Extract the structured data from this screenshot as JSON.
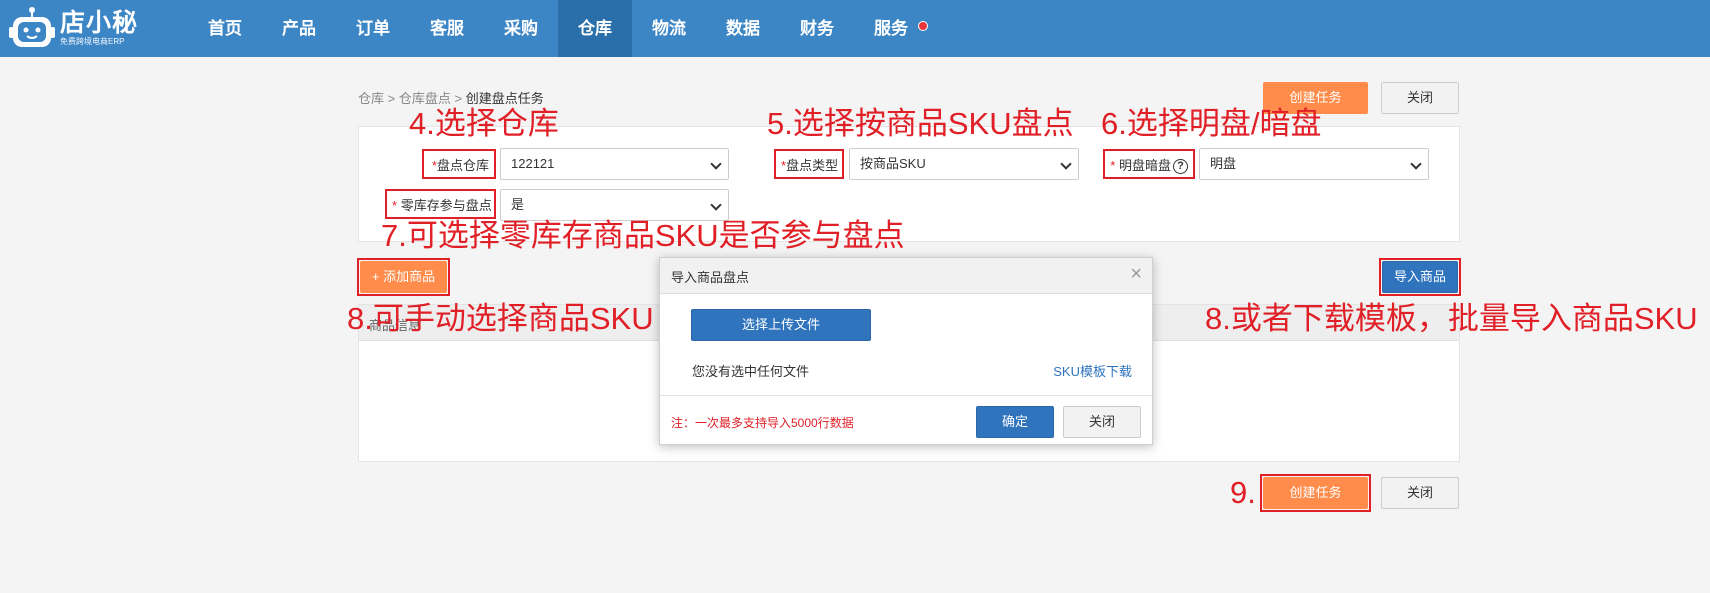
{
  "app": {
    "logo_text": "店小秘",
    "logo_sub": "免费跨境电商ERP"
  },
  "nav": {
    "items": [
      "首页",
      "产品",
      "订单",
      "客服",
      "采购",
      "仓库",
      "物流",
      "数据",
      "财务",
      "服务"
    ],
    "active": "仓库"
  },
  "breadcrumb": {
    "part1": "仓库",
    "sep": ">",
    "part2": "仓库盘点",
    "current": "创建盘点任务"
  },
  "actions": {
    "create_label": "创建任务",
    "close_label": "关闭"
  },
  "form": {
    "warehouse_label": "盘点仓库",
    "warehouse_value": "122121",
    "type_label": "盘点类型",
    "type_value": "按商品SKU",
    "mode_label": "明盘暗盘",
    "mode_value": "明盘",
    "zero_label": "零库存参与盘点",
    "zero_value": "是",
    "required_mark": "*",
    "help_icon_glyph": "?"
  },
  "buttons": {
    "add_product": "+ 添加商品",
    "import_product": "导入商品"
  },
  "table": {
    "col_product_info": "商品信息"
  },
  "modal": {
    "title": "导入商品盘点",
    "close_glyph": "×",
    "upload_label": "选择上传文件",
    "no_file_text": "您没有选中任何文件",
    "template_link": "SKU模板下载",
    "note": "注：一次最多支持导入5000行数据",
    "confirm_label": "确定",
    "close_label": "关闭"
  },
  "annotations": {
    "a4": "4.选择仓库",
    "a5": "5.选择按商品SKU盘点",
    "a6": "6.选择明盘/暗盘",
    "a7": "7.可选择零库存商品SKU是否参与盘点",
    "a8_left": "8.可手动选择商品SKU",
    "a8_right": "8.或者下载模板，批量导入商品SKU",
    "a9": "9."
  },
  "colors": {
    "nav_bg": "#3d86c6",
    "nav_active": "#2a6eaa",
    "accent_orange": "#ff8c4b",
    "primary_blue": "#2f74bd",
    "annotation_red": "#e01f26"
  }
}
